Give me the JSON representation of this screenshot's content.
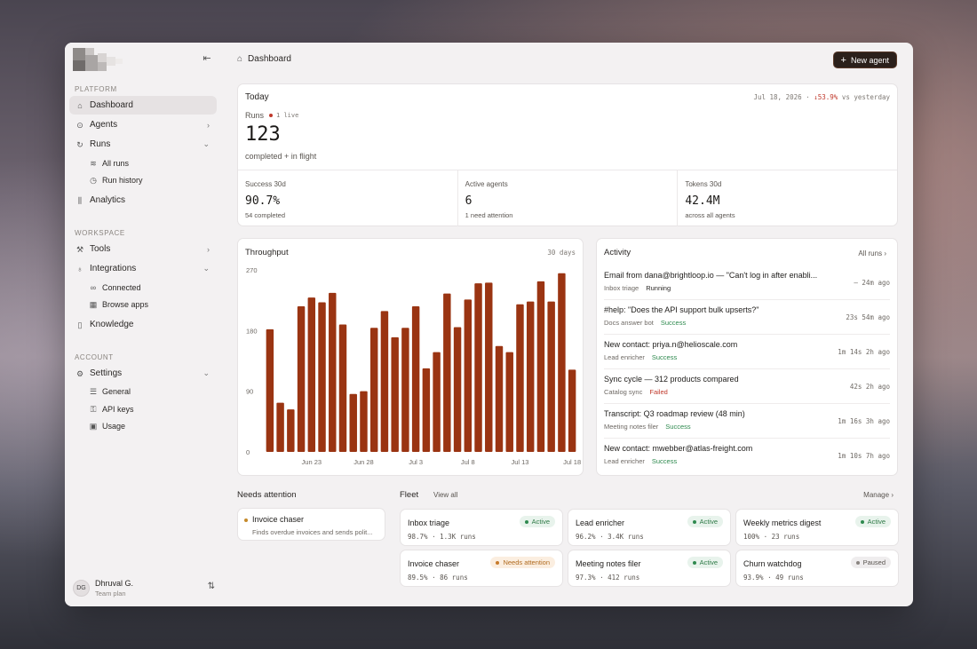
{
  "sidebar": {
    "sections": {
      "platform": "PLATFORM",
      "workspace": "WORKSPACE",
      "account": "ACCOUNT"
    },
    "items": {
      "dashboard": "Dashboard",
      "agents": "Agents",
      "runs": "Runs",
      "all_runs": "All runs",
      "run_history": "Run history",
      "analytics": "Analytics",
      "tools": "Tools",
      "integrations": "Integrations",
      "connected": "Connected",
      "browse_apps": "Browse apps",
      "knowledge": "Knowledge",
      "settings": "Settings",
      "general": "General",
      "api_keys": "API keys",
      "usage": "Usage"
    },
    "user": {
      "initials": "DG",
      "name": "Dhruval G.",
      "plan": "Team plan"
    }
  },
  "header": {
    "breadcrumb": "Dashboard",
    "new_agent": "New agent"
  },
  "today": {
    "title": "Today",
    "date": "Jul 18, 2026 ·",
    "delta": "↓53.9%",
    "delta_suffix": "vs yesterday",
    "runs_label": "Runs",
    "live": "1 live",
    "runs_value": "123",
    "runs_sub": "completed + in flight",
    "stats": [
      {
        "label": "Success 30d",
        "value": "90.7%",
        "sub": "54 completed"
      },
      {
        "label": "Active agents",
        "value": "6",
        "sub": "1 need attention"
      },
      {
        "label": "Tokens 30d",
        "value": "42.4M",
        "sub": "across all agents"
      }
    ]
  },
  "throughput": {
    "title": "Throughput",
    "range": "30 days"
  },
  "chart_data": {
    "type": "bar",
    "title": "Throughput",
    "xlabel": "",
    "ylabel": "",
    "ylim": [
      0,
      270
    ],
    "yticks": [
      "270",
      "180",
      "90",
      "0"
    ],
    "xticks": [
      "Jun 23",
      "Jun 28",
      "Jul 3",
      "Jul 8",
      "Jul 13",
      "Jul 18"
    ],
    "bar_color": "#9a3412",
    "values": [
      182,
      73,
      63,
      216,
      229,
      222,
      236,
      189,
      86,
      90,
      184,
      209,
      170,
      184,
      216,
      124,
      148,
      235,
      185,
      226,
      250,
      251,
      157,
      148,
      219,
      223,
      253,
      223,
      265,
      122
    ]
  },
  "activity": {
    "title": "Activity",
    "all_runs": "All runs",
    "rows": [
      {
        "title": "Email from dana@brightloop.io — \"Can't log in after enabli...",
        "agent": "Inbox triage",
        "status": "Running",
        "status_kind": "running",
        "time": "–  24m ago"
      },
      {
        "title": "#help: \"Does the API support bulk upserts?\"",
        "agent": "Docs answer bot",
        "status": "Success",
        "status_kind": "success",
        "time": "23s  54m ago"
      },
      {
        "title": "New contact: priya.n@helioscale.com",
        "agent": "Lead enricher",
        "status": "Success",
        "status_kind": "success",
        "time": "1m 14s  2h ago"
      },
      {
        "title": "Sync cycle — 312 products compared",
        "agent": "Catalog sync",
        "status": "Failed",
        "status_kind": "failed",
        "time": "42s  2h ago"
      },
      {
        "title": "Transcript: Q3 roadmap review (48 min)",
        "agent": "Meeting notes filer",
        "status": "Success",
        "status_kind": "success",
        "time": "1m 16s  3h ago"
      },
      {
        "title": "New contact: mwebber@atlas-freight.com",
        "agent": "Lead enricher",
        "status": "Success",
        "status_kind": "success",
        "time": "1m 10s  7h ago"
      }
    ]
  },
  "needs_attention": {
    "title": "Needs attention",
    "view_all": "View all",
    "items": [
      {
        "name": "Invoice chaser",
        "desc": "Finds overdue invoices and sends polit..."
      }
    ]
  },
  "fleet": {
    "title": "Fleet",
    "manage": "Manage",
    "items": [
      {
        "name": "Inbox triage",
        "status": "Active",
        "kind": "active",
        "meta": "98.7% · 1.3K runs"
      },
      {
        "name": "Lead enricher",
        "status": "Active",
        "kind": "active",
        "meta": "96.2% · 3.4K runs"
      },
      {
        "name": "Weekly metrics digest",
        "status": "Active",
        "kind": "active",
        "meta": "100% · 23 runs"
      },
      {
        "name": "Invoice chaser",
        "status": "Needs attention",
        "kind": "attn",
        "meta": "89.5% · 86 runs"
      },
      {
        "name": "Meeting notes filer",
        "status": "Active",
        "kind": "active",
        "meta": "97.3% · 412 runs"
      },
      {
        "name": "Churn watchdog",
        "status": "Paused",
        "kind": "paused",
        "meta": "93.9% · 49 runs"
      }
    ]
  }
}
